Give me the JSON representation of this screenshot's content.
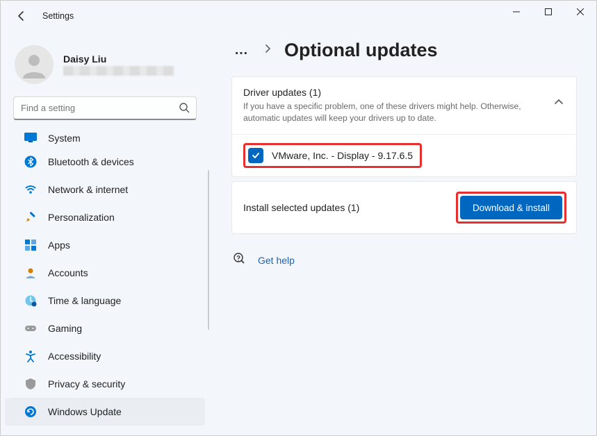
{
  "window": {
    "title": "Settings"
  },
  "user": {
    "name": "Daisy Liu"
  },
  "search": {
    "placeholder": "Find a setting"
  },
  "sidebar": {
    "items": [
      {
        "label": "System"
      },
      {
        "label": "Bluetooth & devices"
      },
      {
        "label": "Network & internet"
      },
      {
        "label": "Personalization"
      },
      {
        "label": "Apps"
      },
      {
        "label": "Accounts"
      },
      {
        "label": "Time & language"
      },
      {
        "label": "Gaming"
      },
      {
        "label": "Accessibility"
      },
      {
        "label": "Privacy & security"
      },
      {
        "label": "Windows Update"
      }
    ]
  },
  "page": {
    "title": "Optional updates"
  },
  "driver_section": {
    "title": "Driver updates (1)",
    "subtitle": "If you have a specific problem, one of these drivers might help. Otherwise, automatic updates will keep your drivers up to date.",
    "items": [
      {
        "label": "VMware, Inc. - Display - 9.17.6.5",
        "checked": true
      }
    ]
  },
  "install": {
    "text": "Install selected updates (1)",
    "button": "Download & install"
  },
  "help": {
    "label": "Get help"
  }
}
